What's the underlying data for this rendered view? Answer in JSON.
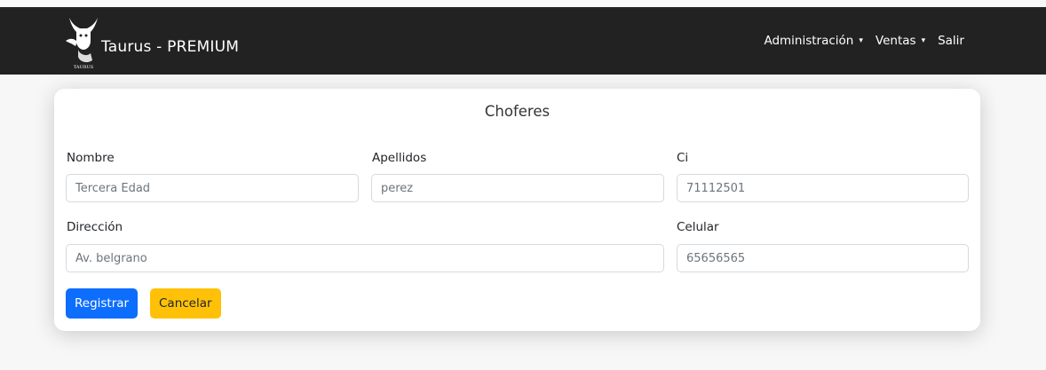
{
  "navbar": {
    "brand": "Taurus - PREMIUM",
    "logo_caption": "TAURUS",
    "menu": [
      {
        "label": "Administración",
        "has_dropdown": true
      },
      {
        "label": "Ventas",
        "has_dropdown": true
      },
      {
        "label": "Salir",
        "has_dropdown": false
      }
    ],
    "caret_icon": "▾"
  },
  "form": {
    "title": "Choferes",
    "fields": {
      "nombre": {
        "label": "Nombre",
        "value": "Tercera Edad"
      },
      "apellidos": {
        "label": "Apellidos",
        "value": "perez"
      },
      "ci": {
        "label": "Ci",
        "value": "71112501"
      },
      "direccion": {
        "label": "Dirección",
        "value": "Av. belgrano"
      },
      "celular": {
        "label": "Celular",
        "value": "65656565"
      }
    },
    "buttons": {
      "registrar": "Registrar",
      "cancelar": "Cancelar"
    }
  },
  "colors": {
    "navbar_bg": "#222222",
    "primary": "#0d6efd",
    "warning": "#ffc107"
  }
}
